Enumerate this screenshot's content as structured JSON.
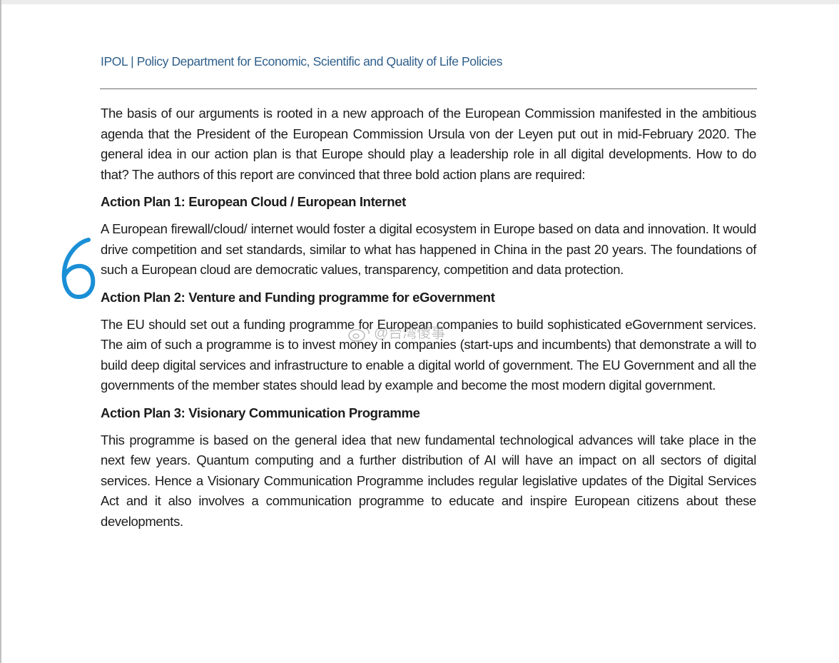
{
  "header": {
    "title": "IPOL | Policy Department for Economic, Scientific and Quality of Life Policies"
  },
  "intro": {
    "text": "The basis of our arguments is rooted in a new approach of the European Commission manifested in the ambitious agenda that the President of the European Commission Ursula von der Leyen put out in mid-February 2020. The general idea in our action plan is that Europe should play a leadership role in all digital developments. How to do that? The authors of this report are convinced that three bold action plans are required:"
  },
  "action_plans": [
    {
      "heading": "Action Plan 1: European Cloud / European Internet",
      "text": "A European firewall/cloud/ internet would foster a digital ecosystem in Europe based on data and innovation. It would drive competition and set standards, similar to what has happened in China in the past 20 years. The foundations of such a European cloud are democratic values, transparency, competition and data protection."
    },
    {
      "heading": "Action Plan 2: Venture and Funding programme for eGovernment",
      "text": "The EU should set out a funding programme for European companies to build sophisticated eGovernment services. The aim of such a programme is to invest money in companies (start-ups and incumbents) that demonstrate a will to build deep digital services and infrastructure to enable a digital world of government. The EU Government and all the governments of the member states should lead by example and become the most modern digital government."
    },
    {
      "heading": "Action Plan 3: Visionary Communication Programme",
      "text": "This programme is based on the general idea that new fundamental technological advances will take place in the next few years. Quantum computing and a further distribution of AI will have an impact on all sectors of digital services. Hence a Visionary Communication Programme includes regular legislative updates of the Digital Services Act and it also involves a communication programme to educate and inspire European citizens about these developments."
    }
  ],
  "annotation": {
    "handwritten_mark": "6",
    "color": "#1a8fd6"
  },
  "watermark": {
    "text": "@台湾傻事"
  },
  "colors": {
    "header_text": "#2f5f8a",
    "body_text": "#1c1c1c"
  }
}
